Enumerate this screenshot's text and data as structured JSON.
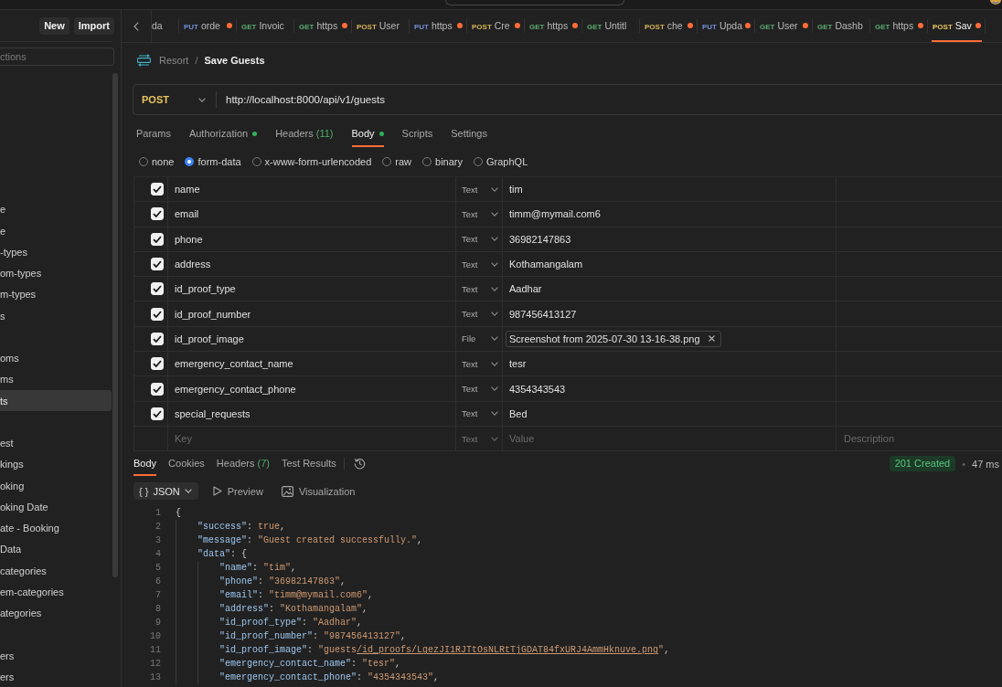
{
  "sidebar": {
    "buttons": [
      "New",
      "Import"
    ],
    "search": {
      "placeholder": "ctions"
    },
    "groups": [
      {
        "items": [
          {
            "label": "e",
            "selected": false
          },
          {
            "label": "e",
            "selected": false
          },
          {
            "label": "-types",
            "selected": false
          },
          {
            "label": "om-types",
            "selected": false
          },
          {
            "label": "m-types",
            "selected": false
          },
          {
            "label": "s",
            "selected": false
          }
        ]
      },
      {
        "items": [
          {
            "label": "oms",
            "selected": false
          },
          {
            "label": "ms",
            "selected": false
          },
          {
            "label": "ts",
            "selected": true
          }
        ]
      },
      {
        "items": [
          {
            "label": "est",
            "selected": false
          },
          {
            "label": "kings",
            "selected": false
          },
          {
            "label": "oking",
            "selected": false
          },
          {
            "label": "oking Date",
            "selected": false
          },
          {
            "label": "ate - Booking",
            "selected": false
          },
          {
            "label": "Data",
            "selected": false
          },
          {
            "label": "categories",
            "selected": false
          },
          {
            "label": "em-categories",
            "selected": false
          },
          {
            "label": "ategories",
            "selected": false
          }
        ]
      },
      {
        "items": [
          {
            "label": "ers",
            "selected": false
          },
          {
            "label": "ers",
            "selected": false
          }
        ]
      }
    ]
  },
  "tabs": [
    {
      "name": "da",
      "unsaved": false,
      "selected": false
    },
    {
      "method": "PUT",
      "color": "#6f8fd6",
      "name": "orde",
      "unsaved": true,
      "selected": false
    },
    {
      "method": "GET",
      "color": "#5aa96e",
      "name": "Invoic",
      "unsaved": false,
      "selected": false
    },
    {
      "method": "GET",
      "color": "#5aa96e",
      "name": "https",
      "unsaved": true,
      "selected": false
    },
    {
      "method": "POST",
      "color": "#d6b458",
      "name": "User",
      "unsaved": false,
      "selected": false
    },
    {
      "method": "PUT",
      "color": "#6f8fd6",
      "name": "https",
      "unsaved": true,
      "selected": false
    },
    {
      "method": "POST",
      "color": "#d6b458",
      "name": "Cre",
      "unsaved": true,
      "selected": false
    },
    {
      "method": "GET",
      "color": "#5aa96e",
      "name": "https",
      "unsaved": true,
      "selected": false
    },
    {
      "method": "GET",
      "color": "#5aa96e",
      "name": "Untitl",
      "unsaved": false,
      "selected": false
    },
    {
      "method": "POST",
      "color": "#d6b458",
      "name": "che",
      "unsaved": true,
      "selected": false
    },
    {
      "method": "PUT",
      "color": "#6f8fd6",
      "name": "Upda",
      "unsaved": true,
      "selected": false
    },
    {
      "method": "GET",
      "color": "#5aa96e",
      "name": "User",
      "unsaved": true,
      "selected": false
    },
    {
      "method": "GET",
      "color": "#5aa96e",
      "name": "Dashb",
      "unsaved": false,
      "selected": false
    },
    {
      "method": "GET",
      "color": "#5aa96e",
      "name": "https",
      "unsaved": true,
      "selected": false
    },
    {
      "method": "POST",
      "color": "#e8c760",
      "name": "Sav",
      "unsaved": true,
      "selected": true
    }
  ],
  "breadcrumb": {
    "items": [
      "Resort",
      "Save Guests"
    ],
    "separator": "/"
  },
  "request": {
    "method": "POST",
    "color": "#e8c35e",
    "url": "http://localhost:8000/api/v1/guests"
  },
  "request_tabs": [
    {
      "label": "Params",
      "dot": false,
      "selected": false
    },
    {
      "label": "Authorization",
      "dot": true,
      "selected": false
    },
    {
      "label": "Headers",
      "count": "(11)",
      "dot": false,
      "selected": false
    },
    {
      "label": "Body",
      "dot": true,
      "selected": true
    },
    {
      "label": "Scripts",
      "dot": false,
      "selected": false
    },
    {
      "label": "Settings",
      "dot": false,
      "selected": false
    }
  ],
  "body_modes": [
    {
      "label": "none",
      "selected": false
    },
    {
      "label": "form-data",
      "selected": true
    },
    {
      "label": "x-www-form-urlencoded",
      "selected": false
    },
    {
      "label": "raw",
      "selected": false
    },
    {
      "label": "binary",
      "selected": false
    },
    {
      "label": "GraphQL",
      "selected": false
    }
  ],
  "form_data": {
    "rows": [
      {
        "kind": "text",
        "enabled": true,
        "key": "name",
        "type": "Text",
        "value": "tim"
      },
      {
        "kind": "text",
        "enabled": true,
        "key": "email",
        "type": "Text",
        "value": "timm@mymail.com6"
      },
      {
        "kind": "text",
        "enabled": true,
        "key": "phone",
        "type": "Text",
        "value": "36982147863"
      },
      {
        "kind": "text",
        "enabled": true,
        "key": "address",
        "type": "Text",
        "value": "Kothamangalam"
      },
      {
        "kind": "text",
        "enabled": true,
        "key": "id_proof_type",
        "type": "Text",
        "value": "Aadhar"
      },
      {
        "kind": "text",
        "enabled": true,
        "key": "id_proof_number",
        "type": "Text",
        "value": "987456413127"
      },
      {
        "kind": "file",
        "enabled": true,
        "key": "id_proof_image",
        "type": "File",
        "value": "Screenshot from 2025-07-30 13-16-38.png"
      },
      {
        "kind": "text",
        "enabled": true,
        "key": "emergency_contact_name",
        "type": "Text",
        "value": "tesr"
      },
      {
        "kind": "text",
        "enabled": true,
        "key": "emergency_contact_phone",
        "type": "Text",
        "value": "4354343543"
      },
      {
        "kind": "text",
        "enabled": true,
        "key": "special_requests",
        "type": "Text",
        "value": "Bed"
      }
    ],
    "new_row": {
      "key": {
        "placeholder": "Key"
      },
      "type": {
        "label": "Text",
        "disabled": true
      },
      "value": {
        "placeholder": "Value"
      },
      "description": {
        "placeholder": "Description"
      }
    }
  },
  "response": {
    "tabs": [
      {
        "label": "Body",
        "selected": true
      },
      {
        "label": "Cookies",
        "selected": false
      },
      {
        "label": "Headers",
        "count": "(7)",
        "selected": false
      },
      {
        "label": "Test Results",
        "selected": false
      }
    ],
    "status": "201 Created",
    "separator": "•",
    "time": "47 ms",
    "format": {
      "icon": "{ }",
      "label": "JSON"
    },
    "views": [
      {
        "kind": "preview",
        "label": "Preview"
      },
      {
        "kind": "visualize",
        "label": "Visualization"
      }
    ],
    "lines": [
      {
        "number": "1",
        "tokens": [
          {
            "kind": "punct",
            "text": "{"
          }
        ],
        "children": [
          {
            "number": "2",
            "tokens": [
              {
                "kind": "key",
                "text": "\"success\""
              },
              {
                "kind": "punct",
                "text": ": "
              },
              {
                "kind": "bool",
                "text": "true"
              },
              {
                "kind": "punct",
                "text": ","
              }
            ]
          },
          {
            "number": "3",
            "tokens": [
              {
                "kind": "key",
                "text": "\"message\""
              },
              {
                "kind": "punct",
                "text": ": "
              },
              {
                "kind": "string",
                "text": "\"Guest created successfully.\""
              },
              {
                "kind": "punct",
                "text": ","
              }
            ]
          },
          {
            "number": "4",
            "tokens": [
              {
                "kind": "key",
                "text": "\"data\""
              },
              {
                "kind": "punct",
                "text": ": {"
              }
            ],
            "children": [
              {
                "number": "5",
                "tokens": [
                  {
                    "kind": "key",
                    "text": "\"name\""
                  },
                  {
                    "kind": "punct",
                    "text": ": "
                  },
                  {
                    "kind": "string",
                    "text": "\"tim\""
                  },
                  {
                    "kind": "punct",
                    "text": ","
                  }
                ]
              },
              {
                "number": "6",
                "tokens": [
                  {
                    "kind": "key",
                    "text": "\"phone\""
                  },
                  {
                    "kind": "punct",
                    "text": ": "
                  },
                  {
                    "kind": "string",
                    "text": "\"36982147863\""
                  },
                  {
                    "kind": "punct",
                    "text": ","
                  }
                ]
              },
              {
                "number": "7",
                "tokens": [
                  {
                    "kind": "key",
                    "text": "\"email\""
                  },
                  {
                    "kind": "punct",
                    "text": ": "
                  },
                  {
                    "kind": "string",
                    "text": "\"timm@mymail.com6\""
                  },
                  {
                    "kind": "punct",
                    "text": ","
                  }
                ]
              },
              {
                "number": "8",
                "tokens": [
                  {
                    "kind": "key",
                    "text": "\"address\""
                  },
                  {
                    "kind": "punct",
                    "text": ": "
                  },
                  {
                    "kind": "string",
                    "text": "\"Kothamangalam\""
                  },
                  {
                    "kind": "punct",
                    "text": ","
                  }
                ]
              },
              {
                "number": "9",
                "tokens": [
                  {
                    "kind": "key",
                    "text": "\"id_proof_type\""
                  },
                  {
                    "kind": "punct",
                    "text": ": "
                  },
                  {
                    "kind": "string",
                    "text": "\"Aadhar\""
                  },
                  {
                    "kind": "punct",
                    "text": ","
                  }
                ]
              },
              {
                "number": "10",
                "tokens": [
                  {
                    "kind": "key",
                    "text": "\"id_proof_number\""
                  },
                  {
                    "kind": "punct",
                    "text": ": "
                  },
                  {
                    "kind": "string",
                    "text": "\"987456413127\""
                  },
                  {
                    "kind": "punct",
                    "text": ","
                  }
                ]
              },
              {
                "number": "11",
                "tokens": [
                  {
                    "kind": "key",
                    "text": "\"id_proof_image\""
                  },
                  {
                    "kind": "punct",
                    "text": ": "
                  },
                  {
                    "kind": "string",
                    "text": "\"guests"
                  },
                  {
                    "kind": "link",
                    "text": "/id_proofs/LgezJI1RJTtOsNLRtTjGDAT84fxURJ4AmmHknuve.png"
                  },
                  {
                    "kind": "string",
                    "text": "\""
                  },
                  {
                    "kind": "punct",
                    "text": ","
                  }
                ]
              },
              {
                "number": "12",
                "tokens": [
                  {
                    "kind": "key",
                    "text": "\"emergency_contact_name\""
                  },
                  {
                    "kind": "punct",
                    "text": ": "
                  },
                  {
                    "kind": "string",
                    "text": "\"tesr\""
                  },
                  {
                    "kind": "punct",
                    "text": ","
                  }
                ]
              },
              {
                "number": "13",
                "tokens": [
                  {
                    "kind": "key",
                    "text": "\"emergency_contact_phone\""
                  },
                  {
                    "kind": "punct",
                    "text": ": "
                  },
                  {
                    "kind": "string",
                    "text": "\"4354343543\""
                  },
                  {
                    "kind": "punct",
                    "text": ","
                  }
                ]
              }
            ]
          }
        ]
      }
    ]
  }
}
